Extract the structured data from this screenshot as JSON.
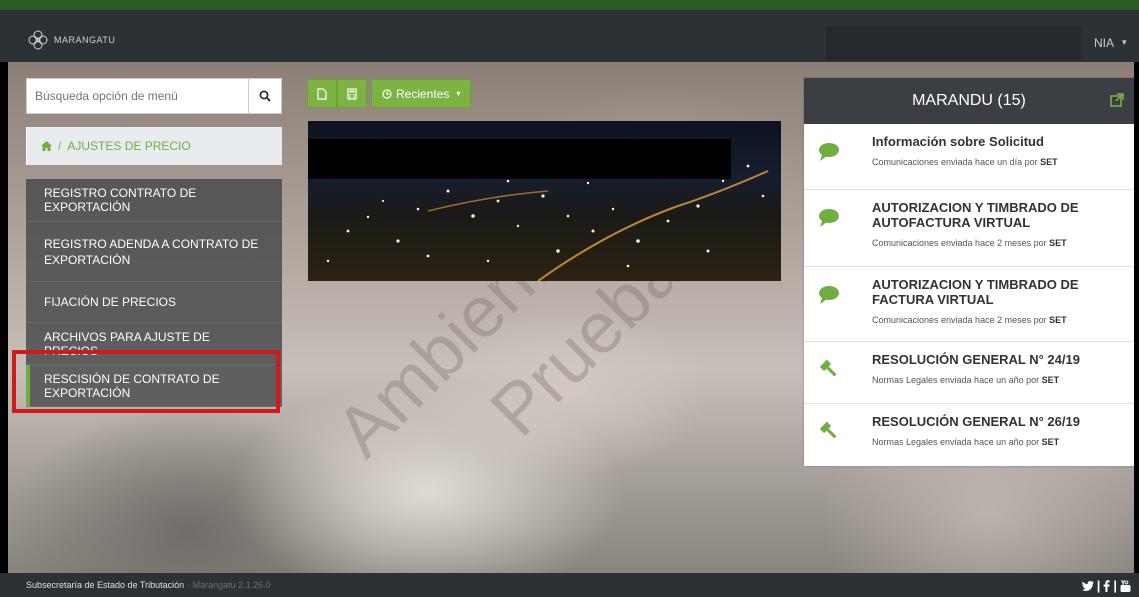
{
  "header": {
    "brand": "MARANGATU",
    "user_name": "NIA",
    "user_caret": "▾"
  },
  "sidebar": {
    "search_placeholder": "Búsqueda opción de menú",
    "breadcrumb_separator": "/",
    "breadcrumb": "AJUSTES DE PRECIO",
    "items": [
      {
        "label": "REGISTRO CONTRATO DE EXPORTACIÓN"
      },
      {
        "label": "REGISTRO ADENDA A CONTRATO DE EXPORTACIÓN"
      },
      {
        "label": "FIJACIÓN DE PRECIOS"
      },
      {
        "label": "ARCHIVOS PARA AJUSTE DE PRECIOS"
      },
      {
        "label": "RESCISIÓN DE CONTRATO DE EXPORTACIÓN"
      }
    ]
  },
  "toolbar": {
    "recent_label": "Recientes"
  },
  "watermark": {
    "line1": "Ambiente de",
    "line2": "Prueba"
  },
  "panel": {
    "title": "MARANDU (15)",
    "notifications": [
      {
        "icon": "comment-icon",
        "title": "Información sobre Solicitud",
        "sub": "Comunicaciones enviada hace un día por",
        "author": "SET"
      },
      {
        "icon": "comment-icon",
        "title": "AUTORIZACION Y TIMBRADO DE AUTOFACTURA VIRTUAL",
        "sub": "Comunicaciones enviada hace 2 meses por",
        "author": "SET"
      },
      {
        "icon": "comment-icon",
        "title": "AUTORIZACION Y TIMBRADO DE FACTURA VIRTUAL",
        "sub": "Comunicaciones enviada hace 2 meses por",
        "author": "SET"
      },
      {
        "icon": "gavel-icon",
        "title": "RESOLUCIÓN GENERAL N° 24/19",
        "sub": "Normas Legales enviada hace un año por",
        "author": "SET"
      },
      {
        "icon": "gavel-icon",
        "title": "RESOLUCIÓN GENERAL N° 26/19",
        "sub": "Normas Legales enviada hace un año por",
        "author": "SET"
      }
    ]
  },
  "footer": {
    "org": "Subsecretaría de Estado de Tributación",
    "version": "- Marangatu 2.1.26.0",
    "social_separator": "|"
  },
  "colors": {
    "accent_green": "#7cb342",
    "highlight_red": "#d11a1a",
    "topbar": "#2c3136"
  }
}
